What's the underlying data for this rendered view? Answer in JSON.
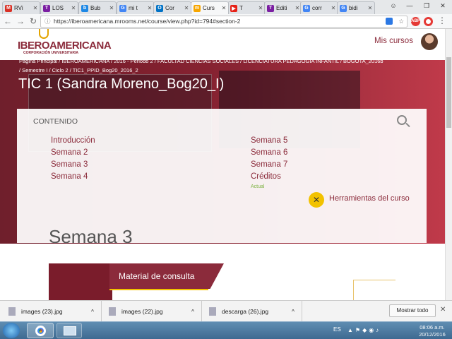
{
  "tabs": [
    {
      "label": "RVi",
      "icon": "gmail-icon",
      "color": "#d93025",
      "glyph": "M"
    },
    {
      "label": "LOS",
      "icon": "T-icon",
      "color": "#7b1fa2",
      "glyph": "T"
    },
    {
      "label": "Bub",
      "icon": "bubbl-icon",
      "color": "#1e88e5",
      "glyph": "b"
    },
    {
      "label": "mi t",
      "icon": "google-icon",
      "color": "#4285f4",
      "glyph": "G"
    },
    {
      "label": "Cor",
      "icon": "outlook-icon",
      "color": "#0072c6",
      "glyph": "O"
    },
    {
      "label": "Curs",
      "icon": "moodle-icon",
      "color": "#f7a600",
      "glyph": "m"
    },
    {
      "label": "T",
      "icon": "youtube-icon",
      "color": "#e62117",
      "glyph": "▶"
    },
    {
      "label": "Editi",
      "icon": "T-icon",
      "color": "#7b1fa2",
      "glyph": "T"
    },
    {
      "label": "corr",
      "icon": "google-icon",
      "color": "#4285f4",
      "glyph": "G"
    },
    {
      "label": "bidi",
      "icon": "google-icon",
      "color": "#4285f4",
      "glyph": "G"
    }
  ],
  "url": "https://iberoamericana.mrooms.net/course/view.php?id=794#section-2",
  "logo": {
    "name": "IBEROAMERICANA",
    "sub": "CORPORACIÓN UNIVERSITARIA"
  },
  "mis_cursos": "Mis cursos",
  "breadcrumb_line1": "Página Principal  /  IBEROAMERICANA  /  2016 - Periodo 2  /  FACULTAD CIENCIAS SOCIALES  /  LICENCIATURA PEDAGOGIA INFANTIL  /  BOGOTA_2016b",
  "breadcrumb_line2": "/  Semestre I  /  Ciclo 2  /  TIC1_PPID_Bog20_2016_2",
  "course_title": "TIC 1 (Sandra Moreno_Bog20_I)",
  "contenido": "CONTENIDO",
  "weeks_left": [
    "Introducción",
    "Semana 2",
    "Semana 3",
    "Semana 4"
  ],
  "weeks_right": [
    "Semana 5",
    "Semana 6",
    "Semana 7",
    "Créditos"
  ],
  "actual_label": "Actual",
  "tools_label": "Herramientas del curso",
  "section_title": "Semana 3",
  "material_label": "Material de consulta",
  "downloads": [
    "images (23).jpg",
    "images (22).jpg",
    "descarga (26).jpg"
  ],
  "show_all": "Mostrar todo",
  "system": {
    "lang": "ES",
    "time": "08:06 a.m.",
    "date": "20/12/2016"
  },
  "colors": {
    "brand": "#8b2b3b",
    "accent": "#c03a4a",
    "tools": "#f2c200"
  }
}
